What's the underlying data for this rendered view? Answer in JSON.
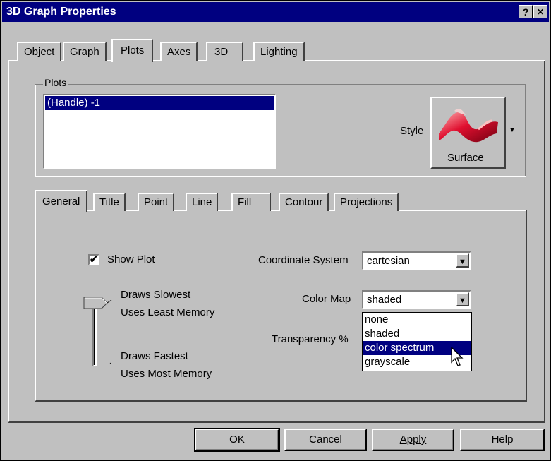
{
  "window": {
    "title": "3D Graph Properties",
    "help_label": "?",
    "close_label": "✕"
  },
  "main_tabs": [
    "Object",
    "Graph",
    "Plots",
    "Axes",
    "3D",
    "Lighting"
  ],
  "main_tab_selected": "Plots",
  "plots_group": {
    "label": "Plots",
    "items": [
      "(Handle) -1"
    ],
    "style_label": "Style",
    "style_button_label": "Surface"
  },
  "sub_tabs": [
    "General",
    "Title",
    "Point",
    "Line",
    "Fill",
    "Contour",
    "Projections"
  ],
  "sub_tab_selected": "General",
  "general": {
    "show_plot_label": "Show Plot",
    "show_plot_checked": true,
    "slider_top_line1": "Draws Slowest",
    "slider_top_line2": "Uses Least Memory",
    "slider_bottom_line1": "Draws Fastest",
    "slider_bottom_line2": "Uses Most Memory",
    "coordinate_system_label": "Coordinate System",
    "coordinate_system_value": "cartesian",
    "color_map_label": "Color Map",
    "color_map_value": "shaded",
    "color_map_options": [
      "none",
      "shaded",
      "color spectrum",
      "grayscale"
    ],
    "color_map_highlighted": "color spectrum",
    "transparency_label": "Transparency %"
  },
  "buttons": {
    "ok": "OK",
    "cancel": "Cancel",
    "apply": "Apply",
    "help": "Help"
  },
  "colors": {
    "title_bar": "#000080",
    "face": "#c0c0c0",
    "selection": "#000080"
  }
}
